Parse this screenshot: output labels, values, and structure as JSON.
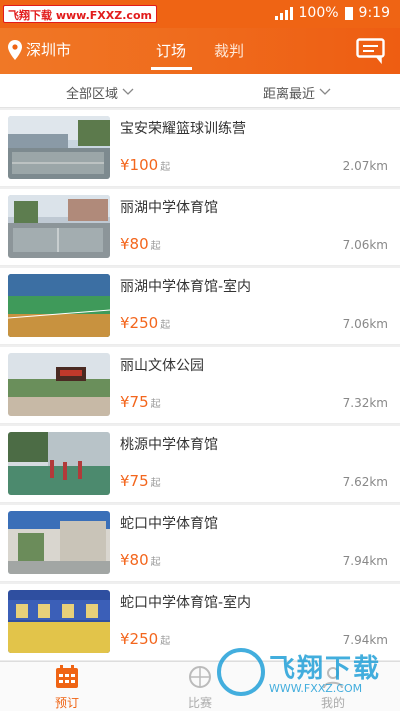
{
  "status_bar": {
    "watermark": "飞翔下载 www.FXXZ.com",
    "battery": "100%",
    "time": "9:19"
  },
  "header": {
    "city": "深圳市",
    "tabs": [
      "订场",
      "裁判"
    ]
  },
  "filters": {
    "area": "全部区域",
    "sort": "距离最近"
  },
  "venues": [
    {
      "name": "宝安荣耀篮球训练营",
      "price": "¥100",
      "price_suffix": "起",
      "distance": "2.07km"
    },
    {
      "name": "丽湖中学体育馆",
      "price": "¥80",
      "price_suffix": "起",
      "distance": "7.06km"
    },
    {
      "name": "丽湖中学体育馆-室内",
      "price": "¥250",
      "price_suffix": "起",
      "distance": "7.06km"
    },
    {
      "name": "丽山文体公园",
      "price": "¥75",
      "price_suffix": "起",
      "distance": "7.32km"
    },
    {
      "name": "桃源中学体育馆",
      "price": "¥75",
      "price_suffix": "起",
      "distance": "7.62km"
    },
    {
      "name": "蛇口中学体育馆",
      "price": "¥80",
      "price_suffix": "起",
      "distance": "7.94km"
    },
    {
      "name": "蛇口中学体育馆-室内",
      "price": "¥250",
      "price_suffix": "起",
      "distance": "7.94km"
    }
  ],
  "tabbar": {
    "book": "预订",
    "match": "比赛",
    "me": "我的"
  },
  "overlay": {
    "logo_text": "飞翔下载",
    "logo_url": "WWW.FXXZ.COM"
  },
  "colors": {
    "accent": "#ef6414",
    "price": "#f3661d",
    "overlay": "#22a0d8"
  }
}
